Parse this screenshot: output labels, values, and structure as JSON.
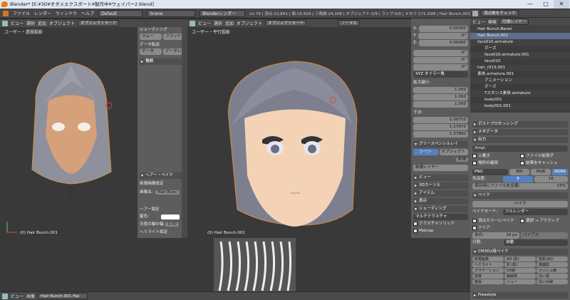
{
  "titlebar": {
    "title": "Blender* [E:¥3D¥オダメエクスポート¥製作中¥ウェイパー2.blend]",
    "min": "—",
    "max": "□",
    "close": "✕"
  },
  "infobar": {
    "menus": [
      "ファイル",
      "レンダー",
      "ウィンドウ",
      "ヘルプ"
    ],
    "layout": "Default",
    "scene": "Scene",
    "engine": "Blenderレンダー",
    "stats": "v2.79 | 頂点:13,841 | 面:16,918 | 三角面:24,108 | オブジェクト:1/9 | ランプ:0/0 | メモリ:171.03M | Hair Bunch.001"
  },
  "left_viewport": {
    "label": "ユーザー・透視投影",
    "status": "(0) Hair Bunch.001",
    "header": [
      "ビュー",
      "選択",
      "追加",
      "オブジェクト",
      "オブジェクトモード"
    ]
  },
  "tool_shelf": {
    "rows": [
      "シェーディング",
      "データ転送",
      "データ",
      "データレ",
      "種類",
      "ヘアー・ベイク",
      "新規画像設定",
      "画像名:",
      "Hair Bunc",
      "ヘアー設定",
      "髪色:",
      "天使の輪の幅",
      "0.50",
      "ヘミライト設定"
    ],
    "tabs": [
      "ツール",
      "作成",
      "リレーション",
      "アニメーション",
      "物理演算"
    ],
    "tool_buttons": [
      "スムー",
      "フラット"
    ]
  },
  "right_viewport": {
    "label": "ユーザー・平行投影",
    "status": "(0) Hair Bunch.001",
    "header": [
      "ビュー",
      "選択",
      "追加",
      "オブジェクト",
      "オブジェクトモード"
    ],
    "shading": "ノーマル"
  },
  "properties_n": {
    "loc": [
      "X:",
      "0.00000",
      "Y:",
      "0°",
      "Z:",
      "0.00000"
    ],
    "rotation_values": [
      "0°",
      "0°",
      "0°"
    ],
    "rotation_mode": "XYZ オイラー角",
    "scale_label": "拡大縮小:",
    "scale": [
      "1.000",
      "1.000",
      "1.000"
    ],
    "dims_label": "寸法:",
    "dims": [
      "1.00753",
      "1.17672",
      "1.37892"
    ],
    "grease": "グリースペンシルレイ",
    "scene_btn": "シーン",
    "object_btn": "オブジェクト",
    "new": "新規",
    "new_layer": "新規レイヤー",
    "sections": [
      "ビュー",
      "3Dカーソル",
      "アイテム",
      "表示",
      "シェーディング"
    ],
    "matcap_label": "マルチテクスチャ",
    "checks": [
      "テクスチャソリッド",
      "Matcap",
      "背面の非表示",
      "被写界深度"
    ]
  },
  "outliner": {
    "header_btn": "頂点数をチェック",
    "view": "ビュー",
    "search": "検索",
    "all": "可視レイヤー",
    "items": [
      "Hair Bunch.Bevel",
      "Hair Bunch.001",
      "face010.armature",
      "ポーズ",
      "face010.armature.001",
      "face010",
      "hair_r013.001",
      "素体.armature.001",
      "アニメーション",
      "ポーズ",
      "Tスタンス素体.armature",
      "body001",
      "body001.001"
    ]
  },
  "render_props": {
    "sections": [
      "ポストプロセッシング",
      "メタデータ",
      "出力",
      "ベイク"
    ],
    "output_path": "/tmp\\",
    "overwrite": "上書き",
    "file_ext": "ファイル拡張子",
    "placeholder": "場所の確保",
    "cache": "結果をキャッシュ",
    "format": "PNG",
    "bw": "BW",
    "rgb": "RGB",
    "rgba": "RGBA",
    "color_depth": "色深度:",
    "d8": "8",
    "d16": "16",
    "compress": "保存時にファイルを圧縮:",
    "compress_val": "15%",
    "bake_btn": "ベイク",
    "bake_mode_label": "ベイクモード:",
    "bake_mode": "フルレンダー",
    "vertex_color": "頂点カラーにベイク",
    "selected_to_active": "選択 → アクティブ",
    "clear": "クリア",
    "margin": "余白:",
    "margin_val": "16 px",
    "bias": "バイアス",
    "distribute": "分割:",
    "distribute_val": "自動",
    "preset": "CM3D2用ベイク",
    "grid": [
      "新規画像",
      "AO (影)",
      "陰影(AO)",
      "ヘミライト",
      "影 (影)",
      "側面陰",
      "グラデーション",
      "UV線",
      "メッシュ線",
      "密度",
      "曲線率",
      "白い黒",
      "金属",
      "シュー",
      "白い太線"
    ],
    "freestyle": "Freestyle"
  },
  "bottom": {
    "header": [
      "ビュー",
      "画像",
      "Hair Bunch.001 Hai"
    ]
  },
  "colors": {
    "accent": "#5680c2",
    "orange": "#e8822a"
  }
}
